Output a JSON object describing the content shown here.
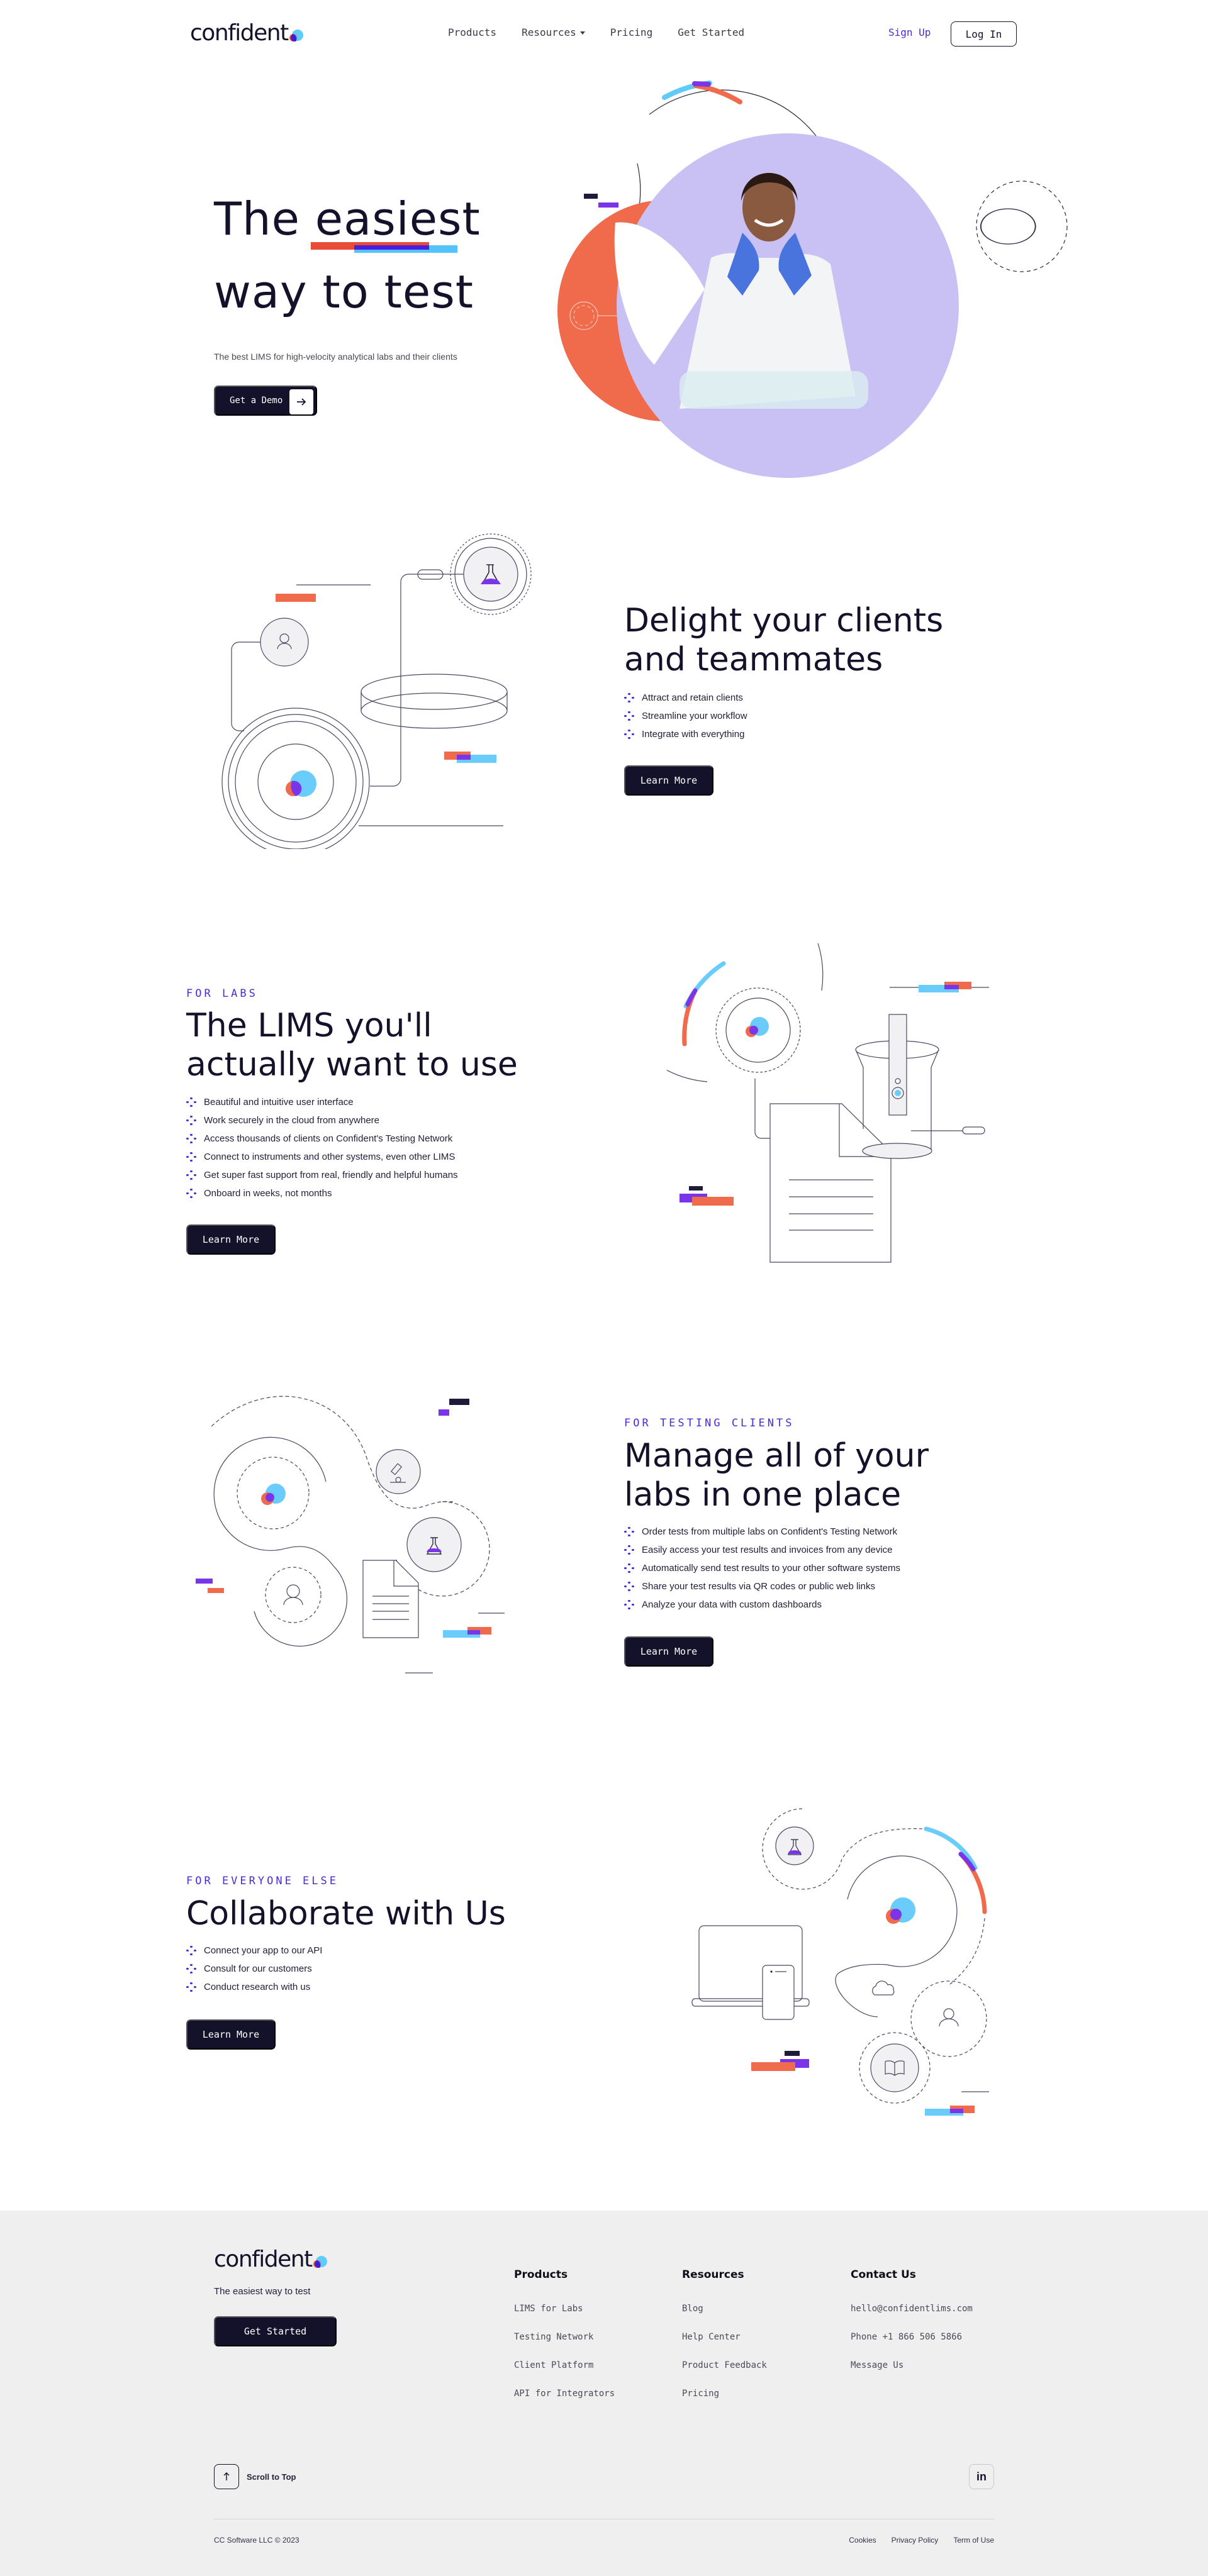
{
  "colors": {
    "ink": "#14122a",
    "accent_purple": "#4a2bd6",
    "orange": "#ef6b4c",
    "sky": "#5fcbfb",
    "violet": "#7a35e8",
    "lavender": "#c9c0f4",
    "footer_bg": "#efefef"
  },
  "nav": {
    "logo": "confident",
    "links": [
      {
        "label": "Products"
      },
      {
        "label": "Resources",
        "has_dropdown": true
      },
      {
        "label": "Pricing"
      },
      {
        "label": "Get Started"
      }
    ],
    "signup": "Sign Up",
    "login": "Log In"
  },
  "hero": {
    "title_line1": "The easiest",
    "title_line2": "way to test",
    "subtitle": "The best LIMS for high-velocity analytical labs and their clients",
    "cta": "Get a Demo",
    "cta_icon": "arrow-right-icon",
    "image_alt": "Smiling scientist in lab coat and blue gloves"
  },
  "sections": [
    {
      "eyebrow": "",
      "title_line1": "Delight your clients",
      "title_line2": "and teammates",
      "bullets": [
        "Attract and retain clients",
        "Streamline your workflow",
        "Integrate with everything"
      ],
      "cta": "Learn More"
    },
    {
      "eyebrow": "FOR LABS",
      "title_line1": "The LIMS you'll",
      "title_line2": "actually want to use",
      "bullets": [
        "Beautiful and intuitive user interface",
        "Work securely in the cloud from anywhere",
        "Access thousands of clients on Confident's Testing Network",
        "Connect to instruments and other systems, even other LIMS",
        "Get super fast support from real, friendly and helpful humans",
        "Onboard in weeks, not months"
      ],
      "cta": "Learn More"
    },
    {
      "eyebrow": "FOR TESTING CLIENTS",
      "title_line1": "Manage all of your",
      "title_line2": "labs in one place",
      "bullets": [
        "Order tests from multiple labs on Confident's Testing Network",
        "Easily access your test results and invoices from any device",
        "Automatically send test results to your other software systems",
        "Share your test results via QR codes or public web links",
        "Analyze your data with custom dashboards"
      ],
      "cta": "Learn More"
    },
    {
      "eyebrow": "FOR EVERYONE ELSE",
      "title_line1": "Collaborate with Us",
      "bullets": [
        "Connect your app to our API",
        "Consult for our customers",
        "Conduct research with us"
      ],
      "cta": "Learn More"
    }
  ],
  "footer": {
    "logo": "confident",
    "tagline": "The easiest way to test",
    "cta": "Get Started",
    "columns": [
      {
        "heading": "Products",
        "links": [
          "LIMS for Labs",
          "Testing Network",
          "Client Platform",
          "API for Integrators"
        ]
      },
      {
        "heading": "Resources",
        "links": [
          "Blog",
          "Help Center",
          "Product Feedback",
          "Pricing"
        ]
      },
      {
        "heading": "Contact Us",
        "links": [
          "hello@confidentlims.com",
          "Phone +1 866 506 5866",
          "Message Us"
        ]
      }
    ],
    "scroll_to_top": "Scroll to Top",
    "social": "in",
    "copyright": "CC Software LLC © 2023",
    "legal": [
      "Cookies",
      "Privacy Policy",
      "Term of Use"
    ]
  }
}
